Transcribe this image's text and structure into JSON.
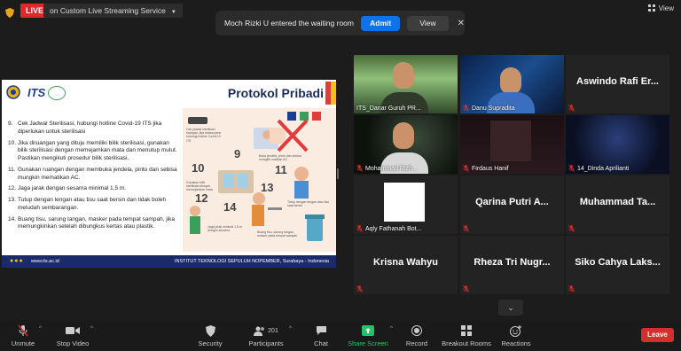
{
  "topbar": {
    "live_label": "LIVE",
    "stream_target": "on Custom Live Streaming Service",
    "view_label": "View"
  },
  "notification": {
    "text": "Moch Rizki U entered the waiting room",
    "admit_label": "Admit",
    "view_label": "View",
    "close_glyph": "✕"
  },
  "slide": {
    "its_text": "ITS",
    "title": "Protokol Pribadi",
    "items": [
      {
        "num": "9.",
        "text": "Cek Jadwal Sterilisasi, hubungi hotline Covid-19 ITS jika diperlukan untuk sterilisasi"
      },
      {
        "num": "10.",
        "text": "Jika diruangan yang dituju memiliki bilik sterilisasi, gunakan bilik sterilisasi dengan memejamkan mata dan menutup mulut. Pastikan mengikuti prosedur bilik sterilisasi."
      },
      {
        "num": "11.",
        "text": "Gunakan ruangan dengan membuka jendela, pintu dan sebisa mungkin mematikan AC."
      },
      {
        "num": "12.",
        "text": "Jaga jarak dengan sesama minimal 1,5 m."
      },
      {
        "num": "13.",
        "text": "Tutup dengan lengan atau tisu saat bersin dan tidak boleh meludah sembarangan."
      },
      {
        "num": "14.",
        "text": "Buang tisu, sarung tangan, masker pada tempat sampah, jika memungkinkan setelah dibungkus kertas atau plastik."
      }
    ],
    "footer_dots": "●●●",
    "footer_site": "www.its.ac.id",
    "footer_inst": "INSTITUT TEKNOLOGI SEPULUH NOPEMBER, Surabaya - Indonesia",
    "info_numbers": [
      "9",
      "10",
      "11",
      "12",
      "13",
      "14"
    ]
  },
  "participants": [
    {
      "name": "ITS_Danar Guruh PR...",
      "muted": false,
      "active": true,
      "video": true
    },
    {
      "name": "Danu Supradita",
      "muted": true,
      "active": false,
      "video": true
    },
    {
      "name": "Aswindo Rafi Er...",
      "muted": true,
      "active": false,
      "video": false
    },
    {
      "name": "Mohammad Rizh...",
      "muted": true,
      "active": false,
      "video": true
    },
    {
      "name": "Firdaus Hanif",
      "muted": true,
      "active": false,
      "video": true
    },
    {
      "name": "14_Dinda Aprilianti",
      "muted": true,
      "active": false,
      "video": true
    },
    {
      "name": "Aqly Fathanah Bot...",
      "muted": true,
      "active": false,
      "video": true
    },
    {
      "name": "Qarina Putri A...",
      "muted": true,
      "active": false,
      "video": false
    },
    {
      "name": "Muhammad Ta...",
      "muted": true,
      "active": false,
      "video": false
    },
    {
      "name": "Krisna Wahyu",
      "muted": true,
      "active": false,
      "video": false
    },
    {
      "name": "Rheza Tri Nugr...",
      "muted": true,
      "active": false,
      "video": false
    },
    {
      "name": "Siko Cahya Laks...",
      "muted": true,
      "active": false,
      "video": false
    }
  ],
  "toolbar": {
    "unmute": "Unmute",
    "stop_video": "Stop Video",
    "security": "Security",
    "participants": "Participants",
    "participants_count": "201",
    "chat": "Chat",
    "share_screen": "Share Screen",
    "record": "Record",
    "breakout_rooms": "Breakout Rooms",
    "reactions": "Reactions",
    "leave": "Leave"
  },
  "colors": {
    "live_red": "#e02828",
    "admit_blue": "#0e72ed",
    "share_green": "#25c16a",
    "leave_red": "#d62d2d",
    "active_speaker": "#f4d82b",
    "slide_navy": "#1b2b6a"
  }
}
